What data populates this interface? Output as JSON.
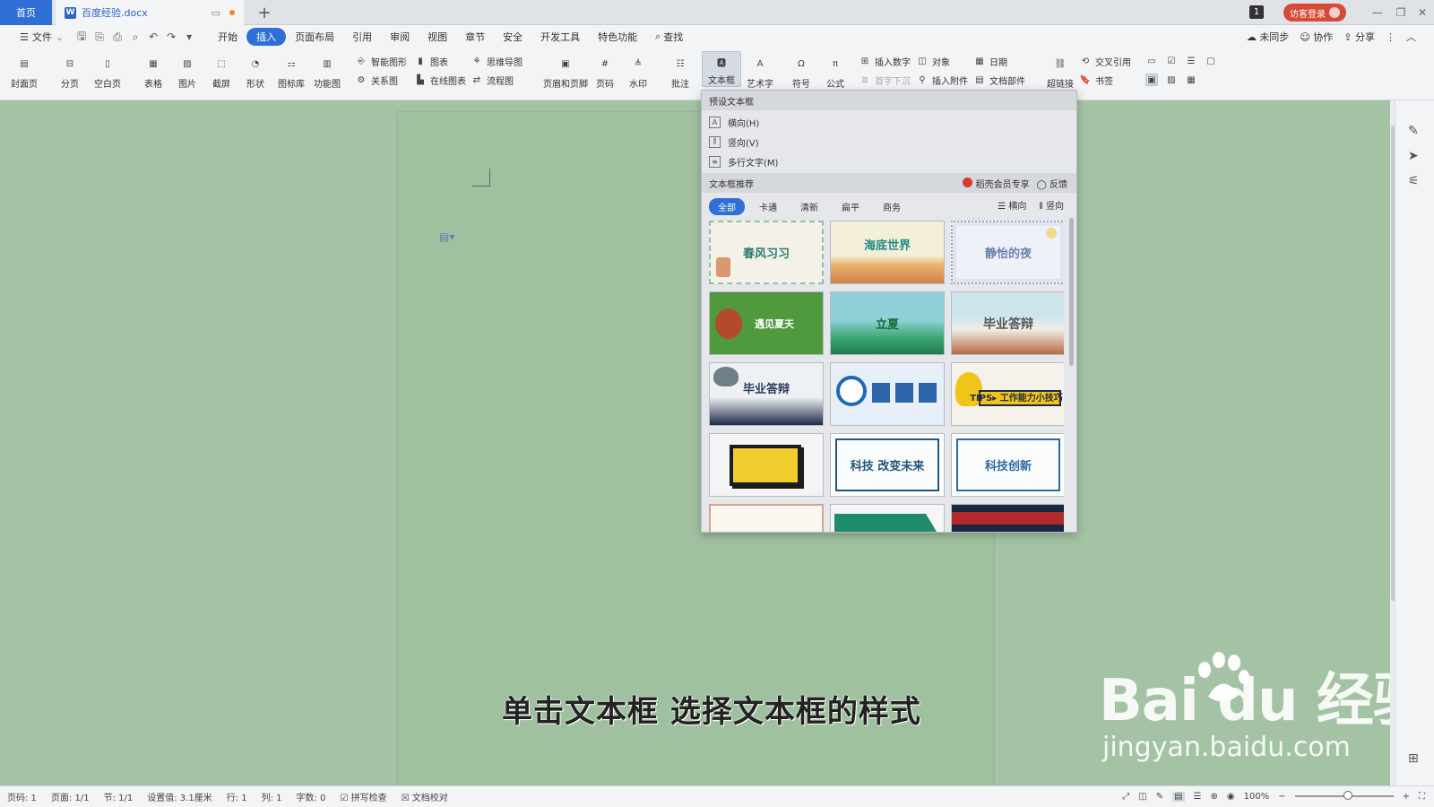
{
  "tabs": {
    "home": "首页",
    "doc": "百度经验.docx",
    "badge": "1",
    "visitor": "访客登录"
  },
  "menu": {
    "file": "文件",
    "items": [
      "开始",
      "插入",
      "页面布局",
      "引用",
      "审阅",
      "视图",
      "章节",
      "安全",
      "开发工具",
      "特色功能"
    ],
    "search": "查找",
    "sync": "未同步",
    "collab": "协作",
    "share": "分享"
  },
  "ribbon": {
    "big": [
      "封面页",
      "分页",
      "空白页",
      "表格",
      "图片",
      "截屏",
      "形状",
      "图标库",
      "功能图",
      "页眉和页脚",
      "页码",
      "水印",
      "批注",
      "文本框",
      "艺术字",
      "符号",
      "公式",
      "超链接"
    ],
    "small": {
      "smart_shape": "智能图形",
      "chart": "图表",
      "mindmap": "思维导图",
      "relation": "关系图",
      "online_chart": "在线图表",
      "flowchart": "流程图",
      "insert_number": "插入数字",
      "object": "对象",
      "date": "日期",
      "dropcap": "首字下沉",
      "attachment": "插入附件",
      "doc_parts": "文档部件",
      "cross_ref": "交叉引用",
      "bookmark": "书签"
    }
  },
  "dropdown": {
    "preset_header": "预设文本框",
    "items": [
      "横向(H)",
      "竖向(V)",
      "多行文字(M)"
    ],
    "rec_header": "文本框推荐",
    "vip": "稻壳会员专享",
    "feedback": "反馈",
    "filters": [
      "全部",
      "卡通",
      "清新",
      "扁平",
      "商务"
    ],
    "orient": [
      "横向",
      "竖向"
    ],
    "cards": [
      "春风习习",
      "海底世界",
      "静怡的夜",
      "遇见夏天",
      "立夏",
      "毕业答辩",
      "毕业答辩",
      "",
      "TIPS▸ 工作能力小技巧",
      "",
      "科技 改变未来",
      "科技创新"
    ]
  },
  "caption": "单击文本框  选择文本框的样式",
  "watermark": {
    "logo": "Bai du 经验",
    "url": "jingyan.baidu.com"
  },
  "status": {
    "page_code": "页码: 1",
    "pages": "页面: 1/1",
    "section": "节: 1/1",
    "setting": "设置值: 3.1厘米",
    "row": "行: 1",
    "col": "列: 1",
    "words": "字数: 0",
    "spell": "拼写检查",
    "proof": "文档校对",
    "zoom": "100%"
  }
}
